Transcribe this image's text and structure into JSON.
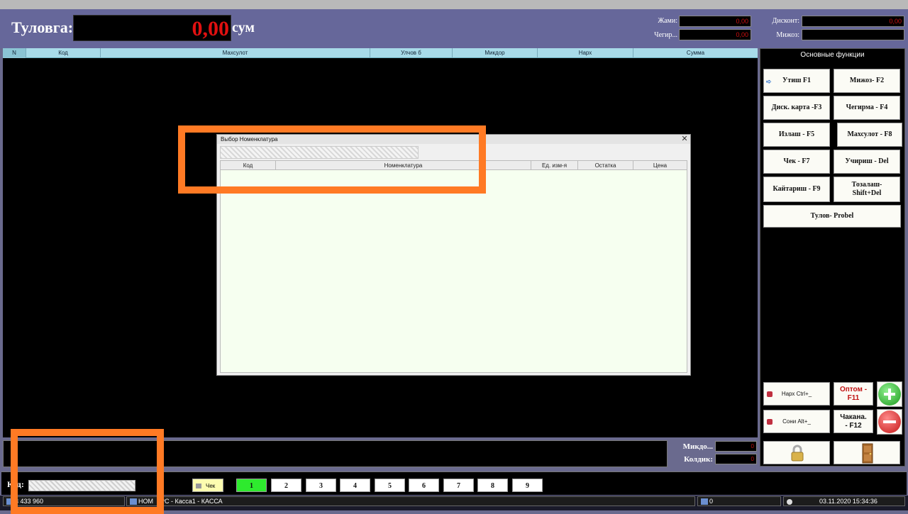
{
  "header": {
    "pay_label": "Туловга:",
    "pay_amount": "0,00",
    "pay_unit": "сум",
    "jami_label": "Жами:",
    "jami_value": "0,00",
    "chegirma_label": "Чегир...",
    "chegirma_value": "0,00",
    "diskont_label": "Дисконт:",
    "diskont_value": "0,00",
    "mijoz_label": "Мижоз:"
  },
  "grid": {
    "columns": [
      "N",
      "Код",
      "Махсулот",
      "Улчов б",
      "Микдор",
      "Нарх",
      "Сумма"
    ]
  },
  "sidebar": {
    "title": "Основные функции",
    "buttons": [
      "Утиш F1",
      "Мижоз- F2",
      "Диск. карта -F3",
      "Чегирма - F4",
      "Излаш - F5",
      "Махсулот - F8",
      "Чек - F7",
      "Учириш - Del",
      "Кайтариш - F9",
      "Тозалаш- Shift+Del",
      "Тулов- Probel"
    ],
    "lower": {
      "narx": "Нарх Ctrl+_",
      "optom": "Оптом - F11",
      "soni": "Сони Alt+_",
      "chakana": "Чакана. - F12"
    }
  },
  "modal": {
    "title": "Выбор Номенклатура",
    "close": "✕",
    "columns": [
      "Код",
      "Номенклатура",
      "Ед. изм-я",
      "Остатка",
      "Цена"
    ]
  },
  "summary": {
    "mikdor_label": "Микдо...",
    "mikdor_value": "0",
    "kolduk_label": "Колдик:",
    "kolduk_value": "0"
  },
  "footer": {
    "kod_label": "Код:",
    "chek_label": "Чек",
    "tabs": [
      "1",
      "2",
      "3",
      "4",
      "5",
      "6",
      "7",
      "8",
      "9"
    ]
  },
  "status": {
    "seg1": "3 433 960",
    "seg2": "НОМ",
    "seg3": "PC - Касса1 - КАССА",
    "seg4": "0",
    "datetime": "03.11.2020 15:34:36"
  }
}
